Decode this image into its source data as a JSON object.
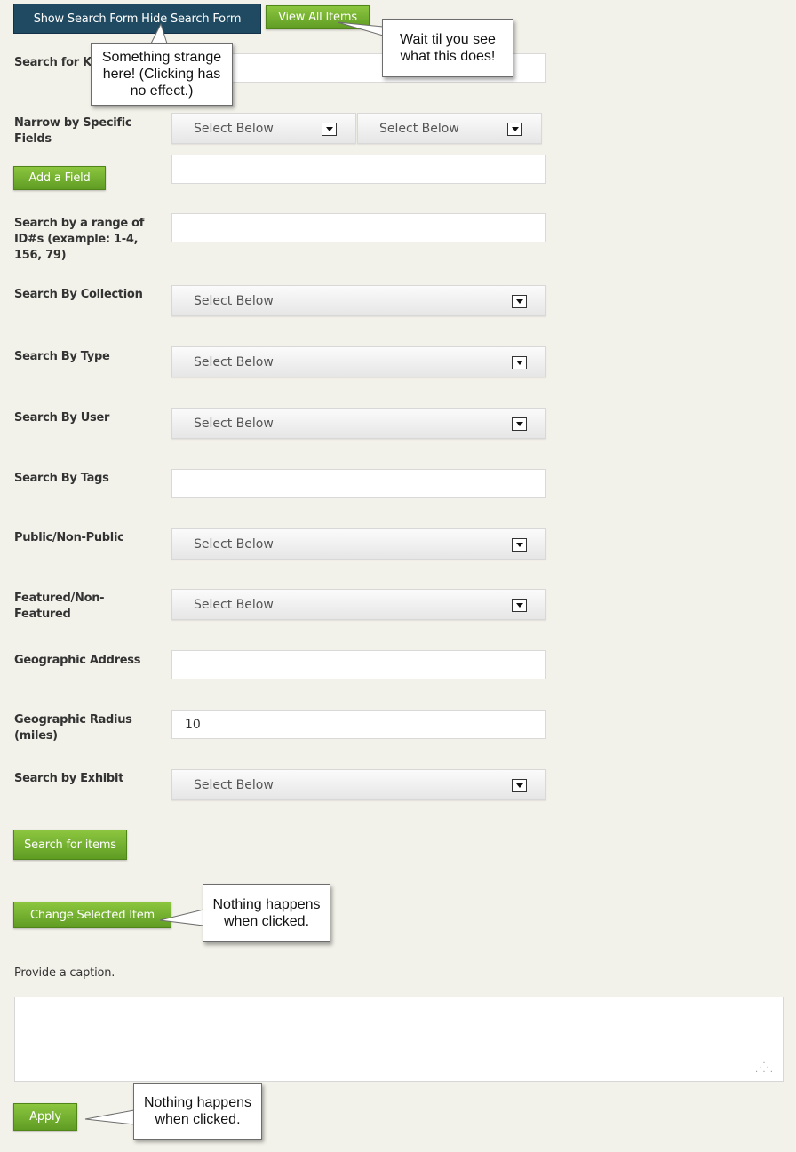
{
  "top_buttons": {
    "show_hide": "Show Search Form Hide Search Form",
    "view_all": "View All Items"
  },
  "fields": {
    "keywords_label": "Search for Ke",
    "narrow_label": "Narrow by Specific Fields",
    "narrow_select_1": "Select Below",
    "narrow_select_2": "Select Below",
    "add_field": "Add a Field",
    "range_label": "Search by a range of ID#s (example: 1-4, 156, 79)",
    "collection_label": "Search By Collection",
    "collection_value": "Select Below",
    "type_label": "Search By Type",
    "type_value": "Select Below",
    "user_label": "Search By User",
    "user_value": "Select Below",
    "tags_label": "Search By Tags",
    "public_label": "Public/Non-Public",
    "public_value": "Select Below",
    "featured_label": "Featured/Non-Featured",
    "featured_value": "Select Below",
    "geo_address_label": "Geographic Address",
    "geo_radius_label": "Geographic Radius (miles)",
    "geo_radius_value": "10",
    "exhibit_label": "Search by Exhibit",
    "exhibit_value": "Select Below"
  },
  "actions": {
    "search": "Search for items",
    "change_item": "Change Selected Item",
    "caption_prompt": "Provide a caption.",
    "apply": "Apply"
  },
  "callouts": {
    "strange": "Something strange here! (Clicking has no effect.)",
    "wait": "Wait til you see what this does!",
    "nothing_1": "Nothing happens when clicked.",
    "nothing_2": "Nothing happens when clicked."
  },
  "colors": {
    "dark_button": "#1f4a61",
    "green_button": "#6fae2b",
    "background": "#f3f2ea"
  }
}
